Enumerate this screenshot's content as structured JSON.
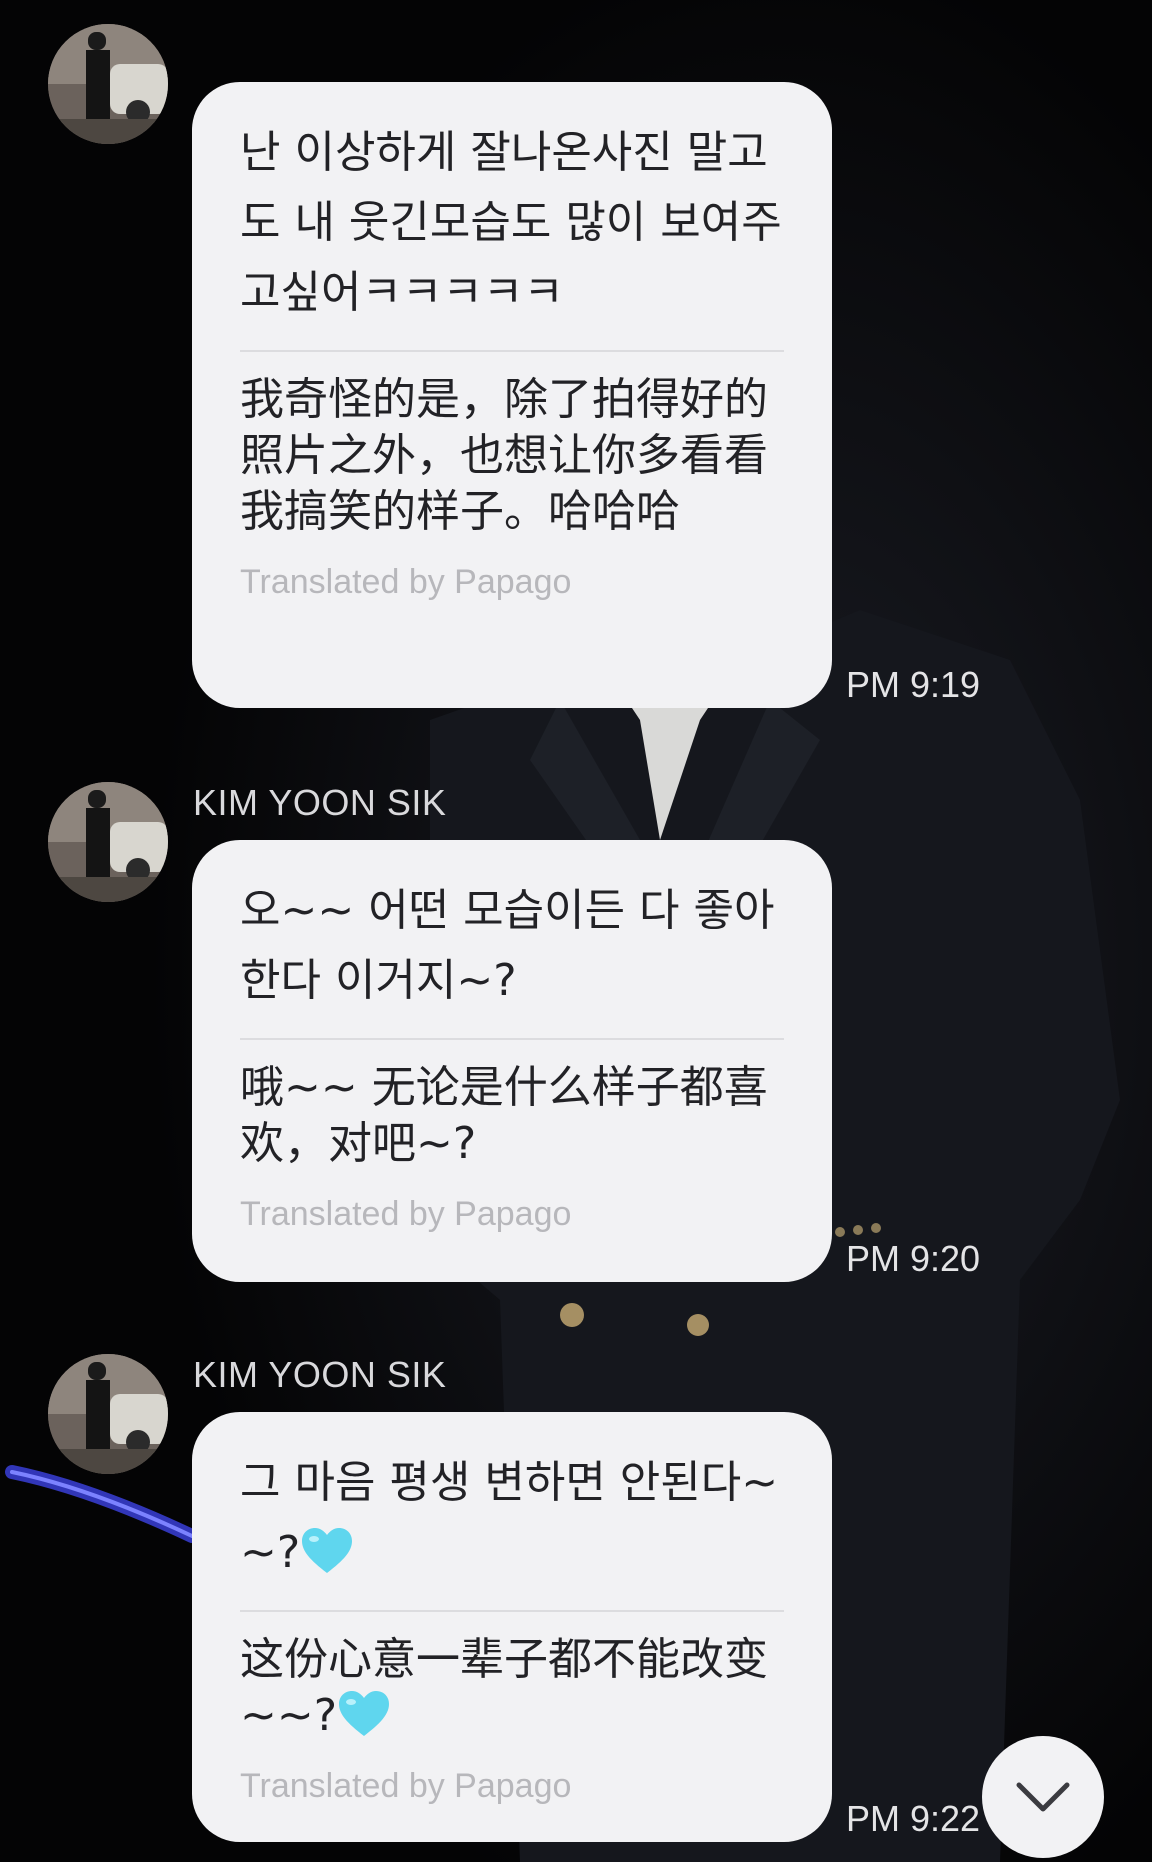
{
  "messages": [
    {
      "sender": "",
      "original": "난 이상하게 잘나온사진 말고도 내 웃긴모습도 많이 보여주고싶어ㅋㅋㅋㅋㅋ",
      "translated": "我奇怪的是，除了拍得好的照片之外，也想让你多看看我搞笑的样子。哈哈哈",
      "credit": "Translated by Papago",
      "time": "PM 9:19"
    },
    {
      "sender": "KIM YOON SIK",
      "original": "오~~ 어떤 모습이든 다 좋아한다 이거지~?",
      "translated": "哦~~ 无论是什么样子都喜欢，对吧~?",
      "credit": "Translated by Papago",
      "time": "PM 9:20"
    },
    {
      "sender": "KIM YOON SIK",
      "original": "그 마음 평생 변하면 안된다~~?",
      "translated": "这份心意一辈子都不能改变~~?",
      "credit": "Translated by Papago",
      "time": "PM 9:22",
      "emoji": "light-blue-heart"
    }
  ],
  "scroll_button_icon": "chevron-down-icon",
  "colors": {
    "bubble": "#f2f2f4",
    "background": "#040405",
    "heart": "#5fd6ee"
  }
}
